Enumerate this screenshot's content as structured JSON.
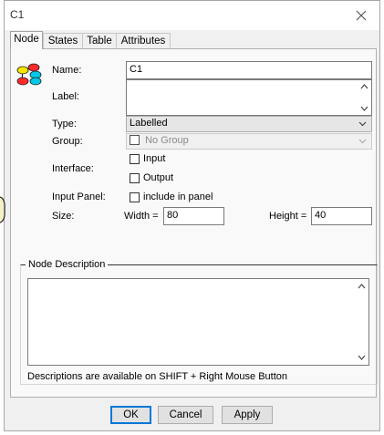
{
  "window": {
    "title": "C1"
  },
  "tabs": [
    {
      "label": "Node"
    },
    {
      "label": "States"
    },
    {
      "label": "Table"
    },
    {
      "label": "Attributes"
    }
  ],
  "form": {
    "name_label": "Name:",
    "name_value": "C1",
    "label_label": "Label:",
    "label_value": "",
    "type_label": "Type:",
    "type_value": "Labelled",
    "group_label": "Group:",
    "group_value": "No Group",
    "interface_label": "Interface:",
    "interface_input": "Input",
    "interface_output": "Output",
    "input_panel_label": "Input Panel:",
    "input_panel_option": "include in panel",
    "size_label": "Size:",
    "width_label": "Width =",
    "width_value": "80",
    "height_label": "Height =",
    "height_value": "40"
  },
  "description": {
    "title": "Node Description",
    "text": "",
    "hint": "Descriptions are available on SHIFT + Right Mouse Button"
  },
  "buttons": {
    "ok": "OK",
    "cancel": "Cancel",
    "apply": "Apply"
  }
}
